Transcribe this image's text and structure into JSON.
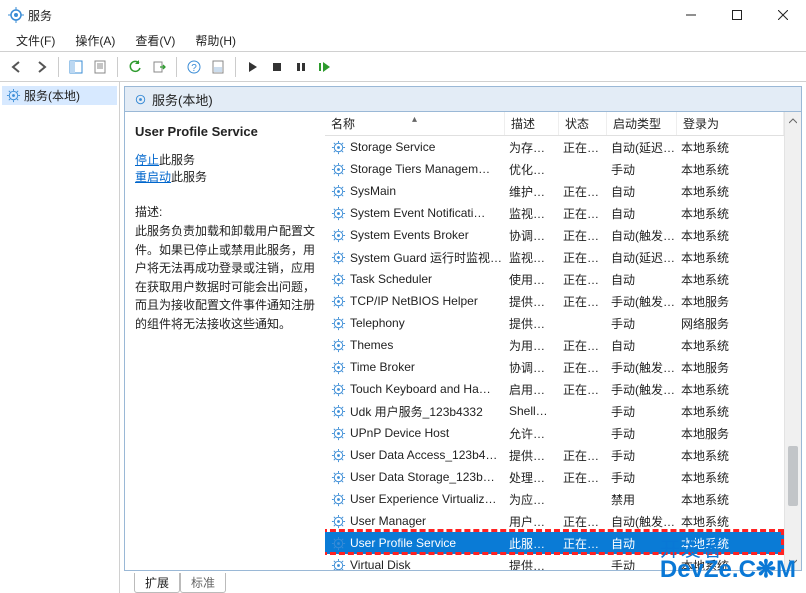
{
  "window": {
    "title": "服务"
  },
  "menu": {
    "file": "文件(F)",
    "action": "操作(A)",
    "view": "查看(V)",
    "help": "帮助(H)"
  },
  "leftPane": {
    "node": "服务(本地)"
  },
  "rightHeader": "服务(本地)",
  "detail": {
    "selectedName": "User Profile Service",
    "stop_link": "停止",
    "stop_suffix": "此服务",
    "restart_link": "重启动",
    "restart_suffix": "此服务",
    "desc_label": "描述:",
    "desc": "此服务负责加载和卸载用户配置文件。如果已停止或禁用此服务，用户将无法再成功登录或注销，应用在获取用户数据时可能会出问题，而且为接收配置文件事件通知注册的组件将无法接收这些通知。"
  },
  "columns": {
    "name": "名称",
    "desc": "描述",
    "status": "状态",
    "start": "启动类型",
    "login": "登录为"
  },
  "rows": [
    {
      "name": "Storage Service",
      "desc": "为存…",
      "status": "正在…",
      "start": "自动(延迟…",
      "login": "本地系统"
    },
    {
      "name": "Storage Tiers Managem…",
      "desc": "优化…",
      "status": "",
      "start": "手动",
      "login": "本地系统"
    },
    {
      "name": "SysMain",
      "desc": "维护…",
      "status": "正在…",
      "start": "自动",
      "login": "本地系统"
    },
    {
      "name": "System Event Notificati…",
      "desc": "监视…",
      "status": "正在…",
      "start": "自动",
      "login": "本地系统"
    },
    {
      "name": "System Events Broker",
      "desc": "协调…",
      "status": "正在…",
      "start": "自动(触发…",
      "login": "本地系统"
    },
    {
      "name": "System Guard 运行时监视…",
      "desc": "监视…",
      "status": "正在…",
      "start": "自动(延迟…",
      "login": "本地系统"
    },
    {
      "name": "Task Scheduler",
      "desc": "使用…",
      "status": "正在…",
      "start": "自动",
      "login": "本地系统"
    },
    {
      "name": "TCP/IP NetBIOS Helper",
      "desc": "提供…",
      "status": "正在…",
      "start": "手动(触发…",
      "login": "本地服务"
    },
    {
      "name": "Telephony",
      "desc": "提供…",
      "status": "",
      "start": "手动",
      "login": "网络服务"
    },
    {
      "name": "Themes",
      "desc": "为用…",
      "status": "正在…",
      "start": "自动",
      "login": "本地系统"
    },
    {
      "name": "Time Broker",
      "desc": "协调…",
      "status": "正在…",
      "start": "手动(触发…",
      "login": "本地服务"
    },
    {
      "name": "Touch Keyboard and Ha…",
      "desc": "启用…",
      "status": "正在…",
      "start": "手动(触发…",
      "login": "本地系统"
    },
    {
      "name": "Udk 用户服务_123b4332",
      "desc": "Shell…",
      "status": "",
      "start": "手动",
      "login": "本地系统"
    },
    {
      "name": "UPnP Device Host",
      "desc": "允许…",
      "status": "",
      "start": "手动",
      "login": "本地服务"
    },
    {
      "name": "User Data Access_123b4…",
      "desc": "提供…",
      "status": "正在…",
      "start": "手动",
      "login": "本地系统"
    },
    {
      "name": "User Data Storage_123b…",
      "desc": "处理…",
      "status": "正在…",
      "start": "手动",
      "login": "本地系统"
    },
    {
      "name": "User Experience Virtualiz…",
      "desc": "为应…",
      "status": "",
      "start": "禁用",
      "login": "本地系统"
    },
    {
      "name": "User Manager",
      "desc": "用户…",
      "status": "正在…",
      "start": "自动(触发…",
      "login": "本地系统"
    },
    {
      "name": "User Profile Service",
      "desc": "此服…",
      "status": "正在…",
      "start": "自动",
      "login": "本地系统",
      "selected": true
    },
    {
      "name": "Virtual Disk",
      "desc": "提供…",
      "status": "",
      "start": "手动",
      "login": "本地系统"
    }
  ],
  "tabs": {
    "extended": "扩展",
    "standard": "标准"
  },
  "watermark": {
    "l1": "开发者",
    "l2": "DevZe.C❋M"
  }
}
